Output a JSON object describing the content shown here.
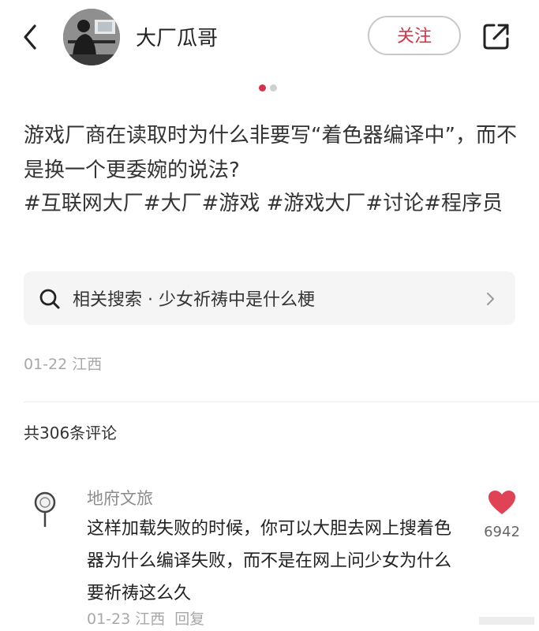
{
  "header": {
    "author_name": "大厂瓜哥",
    "follow_label": "关注"
  },
  "carousel": {
    "total": 2,
    "active": 1
  },
  "post": {
    "title": "游戏厂商在读取时为什么非要写“着色器编译中”，而不是换一个更委婉的说法?",
    "tags": "#互联网大厂#大厂#游戏 #游戏大厂#讨论#程序员",
    "related_search": "相关搜索 · 少女祈祷中是什么梗",
    "meta": "01-22 江西"
  },
  "comments": {
    "count_label": "共306条评论",
    "items": [
      {
        "user": "地府文旅",
        "text": "这样加载失败的时候，你可以大胆去网上搜着色器为什么编译失败，而不是在网上问少女为什么要祈祷这么久",
        "meta": "01-23 江西",
        "reply_label": "回复",
        "likes": "6942"
      }
    ]
  },
  "icons": {
    "back": "back-arrow-icon",
    "share": "share-icon",
    "search": "search-icon",
    "chevron": "chevron-right-icon",
    "like": "heart-icon"
  },
  "colors": {
    "accent": "#d5334a",
    "muted": "#a8a8a8",
    "search_bg": "#f5f5f5"
  }
}
